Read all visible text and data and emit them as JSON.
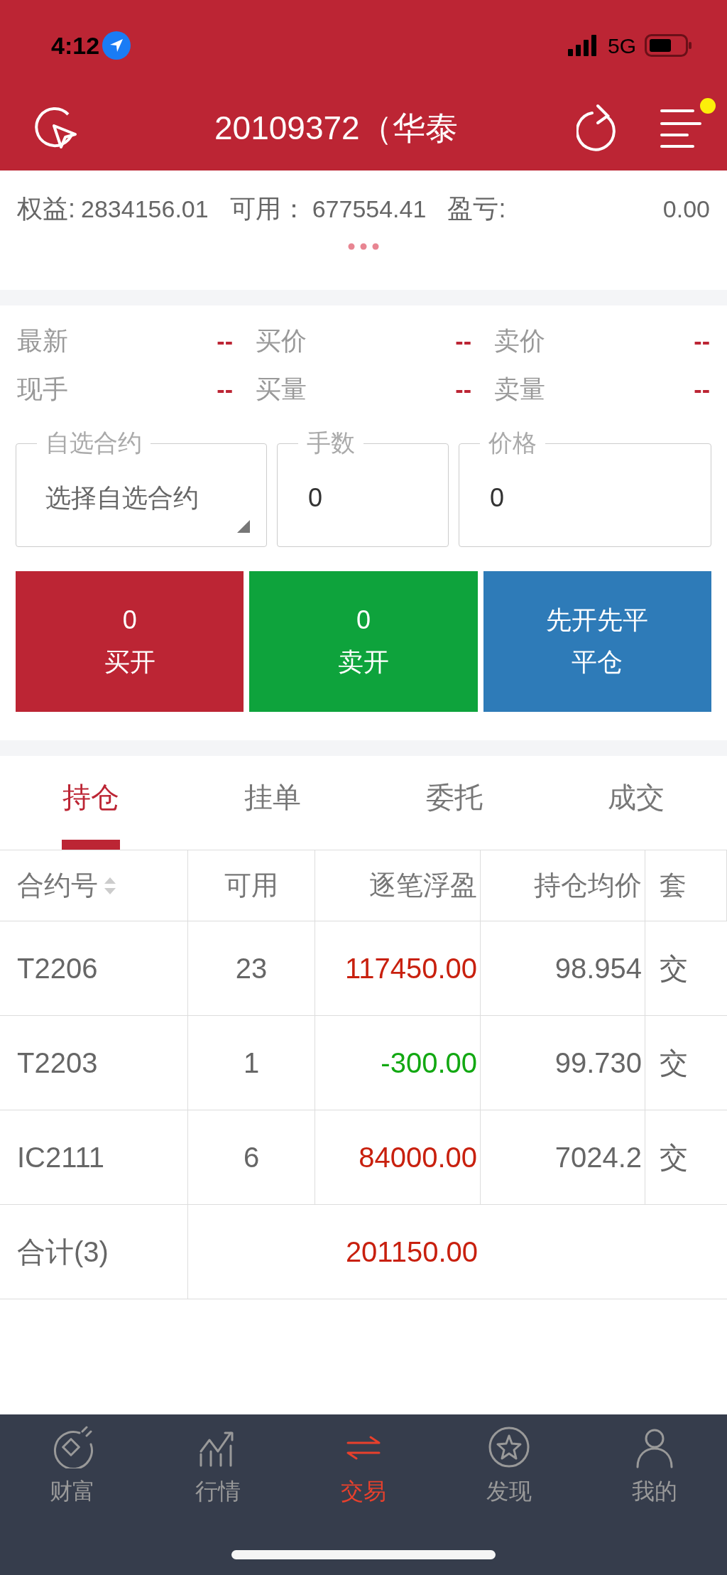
{
  "status_bar": {
    "time": "4:12",
    "network": "5G"
  },
  "header": {
    "title": "20109372（华泰",
    "notification": true
  },
  "summary": [
    {
      "label": "权益:",
      "value": "2834156.01"
    },
    {
      "label": "可用：",
      "value": "677554.41"
    },
    {
      "label": "盈亏:",
      "value": "0.00"
    }
  ],
  "quotes": [
    {
      "label": "最新",
      "value": "--"
    },
    {
      "label": "买价",
      "value": "--"
    },
    {
      "label": "卖价",
      "value": "--"
    },
    {
      "label": "现手",
      "value": "--"
    },
    {
      "label": "买量",
      "value": "--"
    },
    {
      "label": "卖量",
      "value": "--"
    }
  ],
  "fields": [
    {
      "kind": "select",
      "label": "自选合约",
      "value": "选择自选合约"
    },
    {
      "kind": "input",
      "label": "手数",
      "value": "0"
    },
    {
      "kind": "input",
      "label": "价格",
      "value": "0"
    }
  ],
  "actions": [
    {
      "lines": [
        "0",
        "买开"
      ],
      "color": "#bc2534"
    },
    {
      "lines": [
        "0",
        "卖开"
      ],
      "color": "#0ea33c"
    },
    {
      "lines": [
        "先开先平",
        "平仓"
      ],
      "color": "#2e7bb8"
    }
  ],
  "tabs": [
    {
      "label": "持仓",
      "selected": true
    },
    {
      "label": "挂单",
      "selected": false
    },
    {
      "label": "委托",
      "selected": false
    },
    {
      "label": "成交",
      "selected": false
    }
  ],
  "table": {
    "columns": [
      {
        "label": "合约号",
        "sortable": true
      },
      {
        "label": "可用",
        "sortable": false
      },
      {
        "label": "逐笔浮盈",
        "sortable": false
      },
      {
        "label": "持仓均价",
        "sortable": false
      },
      {
        "label": "套",
        "sortable": false
      }
    ],
    "rows": [
      {
        "cells": [
          "T2206",
          "23",
          "117450.00",
          "98.954",
          "交"
        ],
        "color": "#c8200e"
      },
      {
        "cells": [
          "T2203",
          "1",
          "-300.00",
          "99.730",
          "交"
        ],
        "color": "#12a812"
      },
      {
        "cells": [
          "IC2111",
          "6",
          "84000.00",
          "7024.2",
          "交"
        ],
        "color": "#c8200e"
      }
    ],
    "total": {
      "label": "合计(3)",
      "value": "201150.00"
    }
  },
  "nav": [
    {
      "label": "财富",
      "selected": false
    },
    {
      "label": "行情",
      "selected": false
    },
    {
      "label": "交易",
      "selected": true
    },
    {
      "label": "发现",
      "selected": false
    },
    {
      "label": "我的",
      "selected": false
    }
  ]
}
